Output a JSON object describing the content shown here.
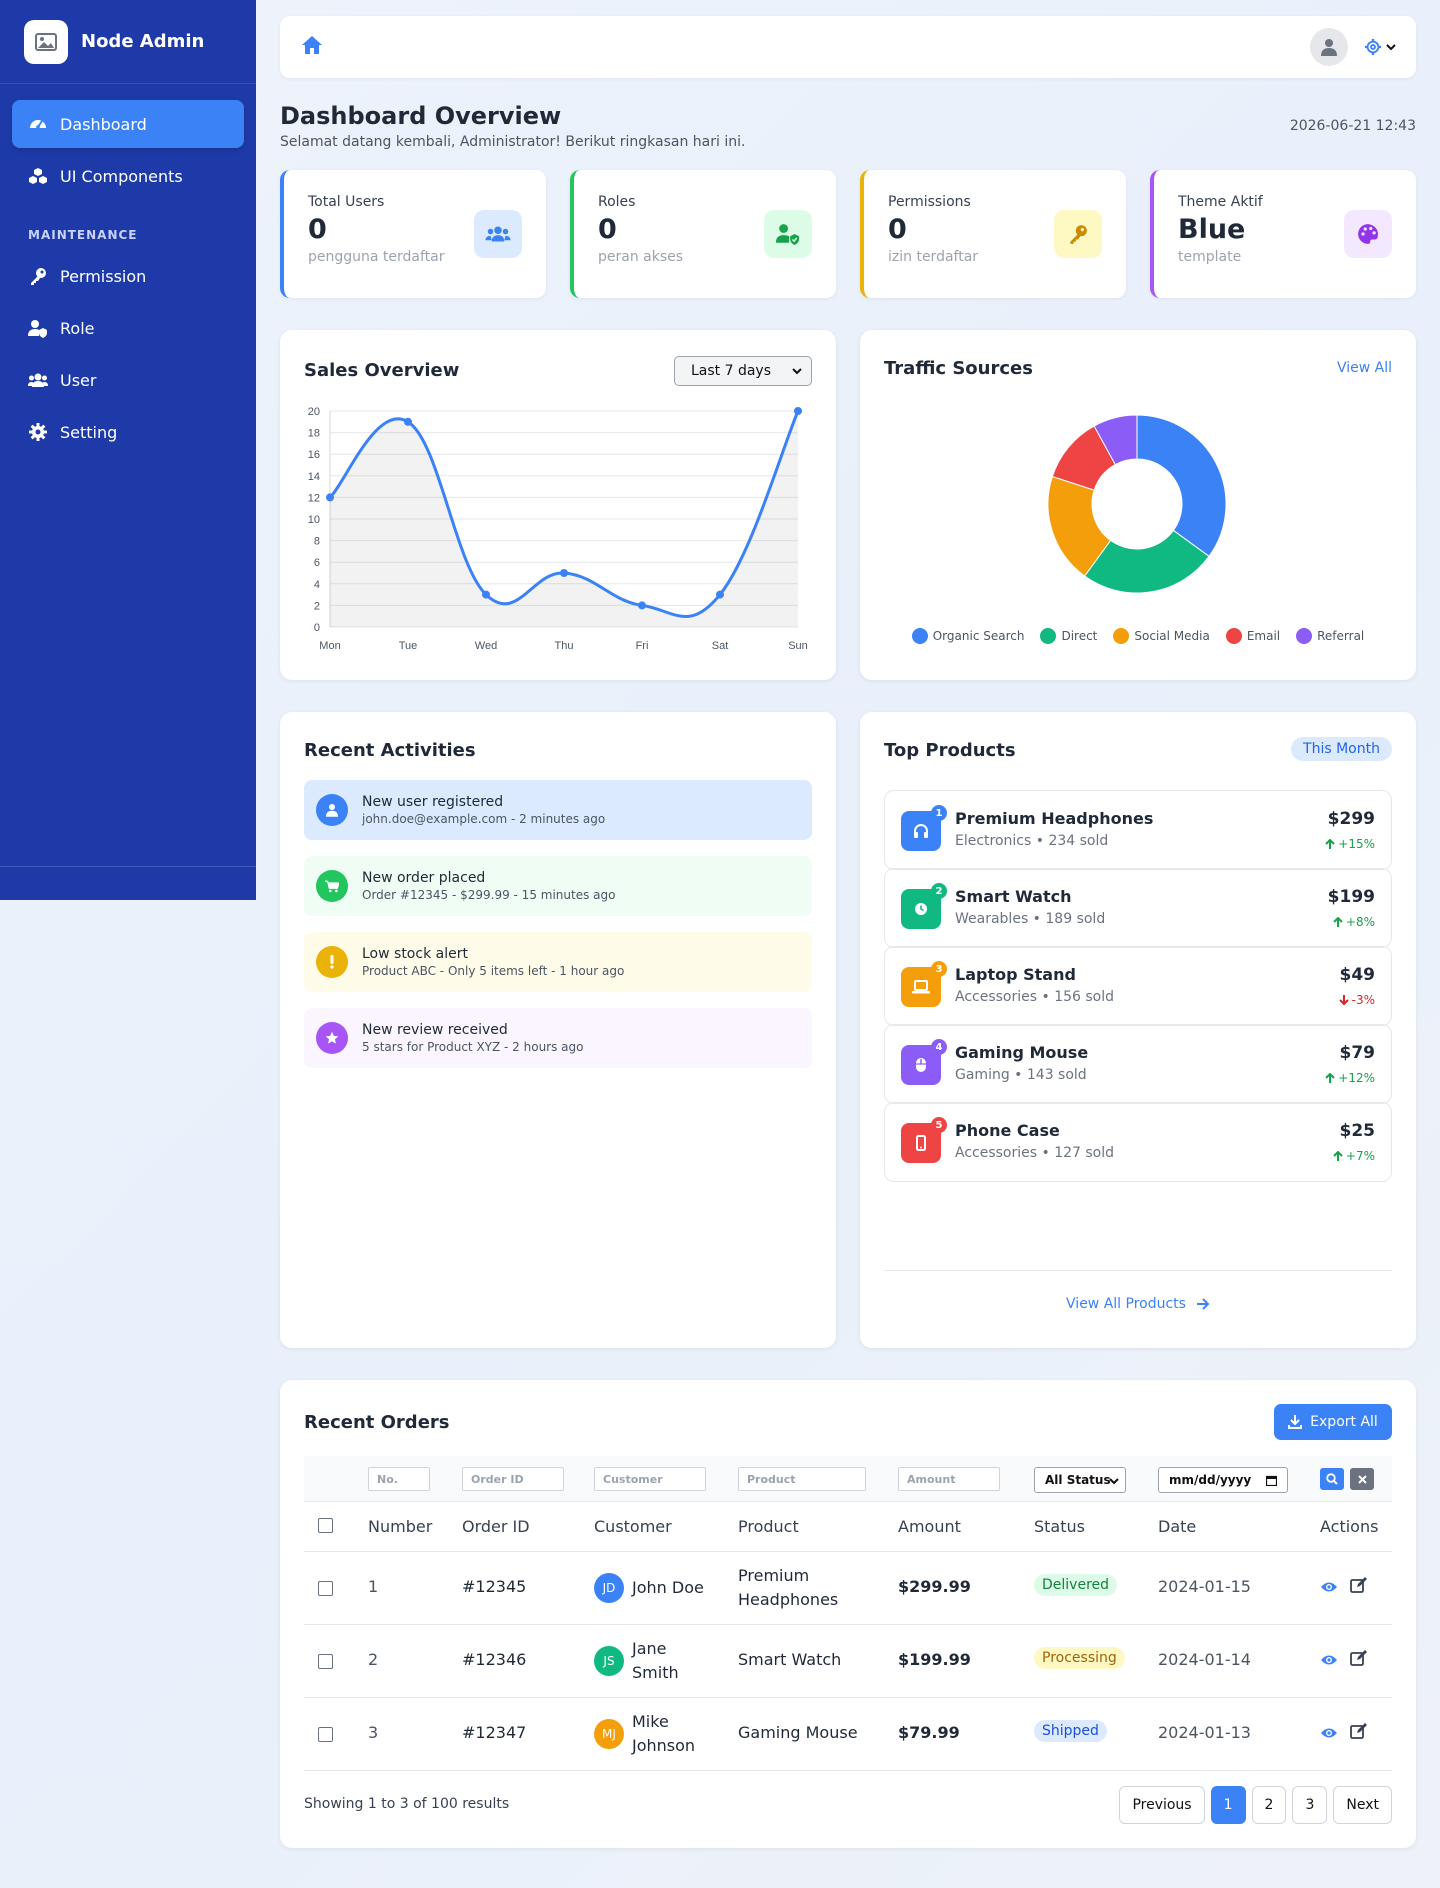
{
  "app": {
    "name": "Node Admin"
  },
  "sidebar": {
    "items": [
      {
        "label": "Dashboard",
        "icon": "gauge-icon",
        "active": true
      },
      {
        "label": "UI Components",
        "icon": "cubes-icon",
        "active": false
      }
    ],
    "section_title": "MAINTENANCE",
    "maintenance_items": [
      {
        "label": "Permission",
        "icon": "key-icon"
      },
      {
        "label": "Role",
        "icon": "user-shield-icon"
      },
      {
        "label": "User",
        "icon": "users-icon"
      },
      {
        "label": "Setting",
        "icon": "gear-icon"
      }
    ]
  },
  "header": {
    "title": "Dashboard Overview",
    "subtitle": "Selamat datang kembali, Administrator! Berikut ringkasan hari ini.",
    "datetime": "2026-06-21 12:43"
  },
  "stats": [
    {
      "label": "Total Users",
      "value": "0",
      "sub": "pengguna terdaftar",
      "color": "#3b82f6",
      "bg": "#dbeafe",
      "icon": "users-icon"
    },
    {
      "label": "Roles",
      "value": "0",
      "sub": "peran akses",
      "color": "#22c55e",
      "bg": "#dcfce7",
      "icon": "user-shield-icon"
    },
    {
      "label": "Permissions",
      "value": "0",
      "sub": "izin terdaftar",
      "color": "#eab308",
      "bg": "#fef9c3",
      "icon": "key-icon"
    },
    {
      "label": "Theme Aktif",
      "value": "Blue",
      "sub": "template",
      "color": "#a855f7",
      "bg": "#f3e8ff",
      "icon": "palette-icon"
    }
  ],
  "sales": {
    "title": "Sales Overview",
    "range": "Last 7 days"
  },
  "traffic": {
    "title": "Traffic Sources",
    "view_all": "View All"
  },
  "chart_data": [
    {
      "type": "line",
      "categories": [
        "Mon",
        "Tue",
        "Wed",
        "Thu",
        "Fri",
        "Sat",
        "Sun"
      ],
      "values": [
        12,
        19,
        3,
        5,
        2,
        3,
        20
      ],
      "ylim": [
        0,
        20
      ],
      "yticks": [
        0,
        2,
        4,
        6,
        8,
        10,
        12,
        14,
        16,
        18,
        20
      ],
      "grid": true,
      "color": "#3b82f6"
    },
    {
      "type": "pie",
      "labels": [
        "Organic Search",
        "Direct",
        "Social Media",
        "Email",
        "Referral"
      ],
      "values": [
        35,
        25,
        20,
        12,
        8
      ],
      "colors": [
        "#3b82f6",
        "#10b981",
        "#f59e0b",
        "#ef4444",
        "#8b5cf6"
      ],
      "legend": "bottom"
    }
  ],
  "activities": {
    "title": "Recent Activities",
    "items": [
      {
        "title": "New user registered",
        "sub": "john.doe@example.com - 2 minutes ago",
        "bg": "#dbeafe",
        "color": "#3b82f6",
        "icon": "user-icon"
      },
      {
        "title": "New order placed",
        "sub": "Order #12345 - $299.99 - 15 minutes ago",
        "bg": "#f0fdf4",
        "color": "#22c55e",
        "icon": "cart-icon"
      },
      {
        "title": "Low stock alert",
        "sub": "Product ABC - Only 5 items left - 1 hour ago",
        "bg": "#fefce8",
        "color": "#eab308",
        "icon": "alert-icon"
      },
      {
        "title": "New review received",
        "sub": "5 stars for Product XYZ - 2 hours ago",
        "bg": "#faf5ff",
        "color": "#a855f7",
        "icon": "star-icon"
      }
    ]
  },
  "products": {
    "title": "Top Products",
    "badge": "This Month",
    "items": [
      {
        "rank": "1",
        "name": "Premium Headphones",
        "meta": "Electronics • 234 sold",
        "price": "$299",
        "change": "+15%",
        "up": true,
        "color": "#3b82f6",
        "icon": "headphones-icon"
      },
      {
        "rank": "2",
        "name": "Smart Watch",
        "meta": "Wearables • 189 sold",
        "price": "$199",
        "change": "+8%",
        "up": true,
        "color": "#10b981",
        "icon": "clock-icon"
      },
      {
        "rank": "3",
        "name": "Laptop Stand",
        "meta": "Accessories • 156 sold",
        "price": "$49",
        "change": "-3%",
        "up": false,
        "color": "#f59e0b",
        "icon": "laptop-icon"
      },
      {
        "rank": "4",
        "name": "Gaming Mouse",
        "meta": "Gaming • 143 sold",
        "price": "$79",
        "change": "+12%",
        "up": true,
        "color": "#8b5cf6",
        "icon": "mouse-icon"
      },
      {
        "rank": "5",
        "name": "Phone Case",
        "meta": "Accessories • 127 sold",
        "price": "$25",
        "change": "+7%",
        "up": true,
        "color": "#ef4444",
        "icon": "phone-icon"
      }
    ],
    "view_all": "View All Products"
  },
  "orders": {
    "title": "Recent Orders",
    "export_label": "Export All",
    "filters": {
      "number": "No.",
      "order_id": "Order ID",
      "customer": "Customer",
      "product": "Product",
      "amount": "Amount",
      "status": "All Status",
      "date": "mm/dd/yyyy"
    },
    "columns": [
      "Number",
      "Order ID",
      "Customer",
      "Product",
      "Amount",
      "Status",
      "Date",
      "Actions"
    ],
    "rows": [
      {
        "number": "1",
        "order_id": "#12345",
        "initials": "JD",
        "customer_first": "John Doe",
        "customer_last": "",
        "avatar_color": "#3b82f6",
        "product_first": "Premium",
        "product_last": "Headphones",
        "amount": "$299.99",
        "status": "Delivered",
        "status_bg": "#dcfce7",
        "status_fg": "#15803d",
        "date": "2024-01-15"
      },
      {
        "number": "2",
        "order_id": "#12346",
        "initials": "JS",
        "customer_first": "Jane",
        "customer_last": "Smith",
        "avatar_color": "#10b981",
        "product_first": "Smart Watch",
        "product_last": "",
        "amount": "$199.99",
        "status": "Processing",
        "status_bg": "#fef9c3",
        "status_fg": "#a16207",
        "date": "2024-01-14"
      },
      {
        "number": "3",
        "order_id": "#12347",
        "initials": "MJ",
        "customer_first": "Mike",
        "customer_last": "Johnson",
        "avatar_color": "#f59e0b",
        "product_first": "Gaming Mouse",
        "product_last": "",
        "amount": "$79.99",
        "status": "Shipped",
        "status_bg": "#dbeafe",
        "status_fg": "#1d4ed8",
        "date": "2024-01-13"
      }
    ],
    "summary": "Showing 1 to 3 of 100 results",
    "pagination": {
      "prev": "Previous",
      "pages": [
        "1",
        "2",
        "3"
      ],
      "active": "1",
      "next": "Next"
    }
  }
}
